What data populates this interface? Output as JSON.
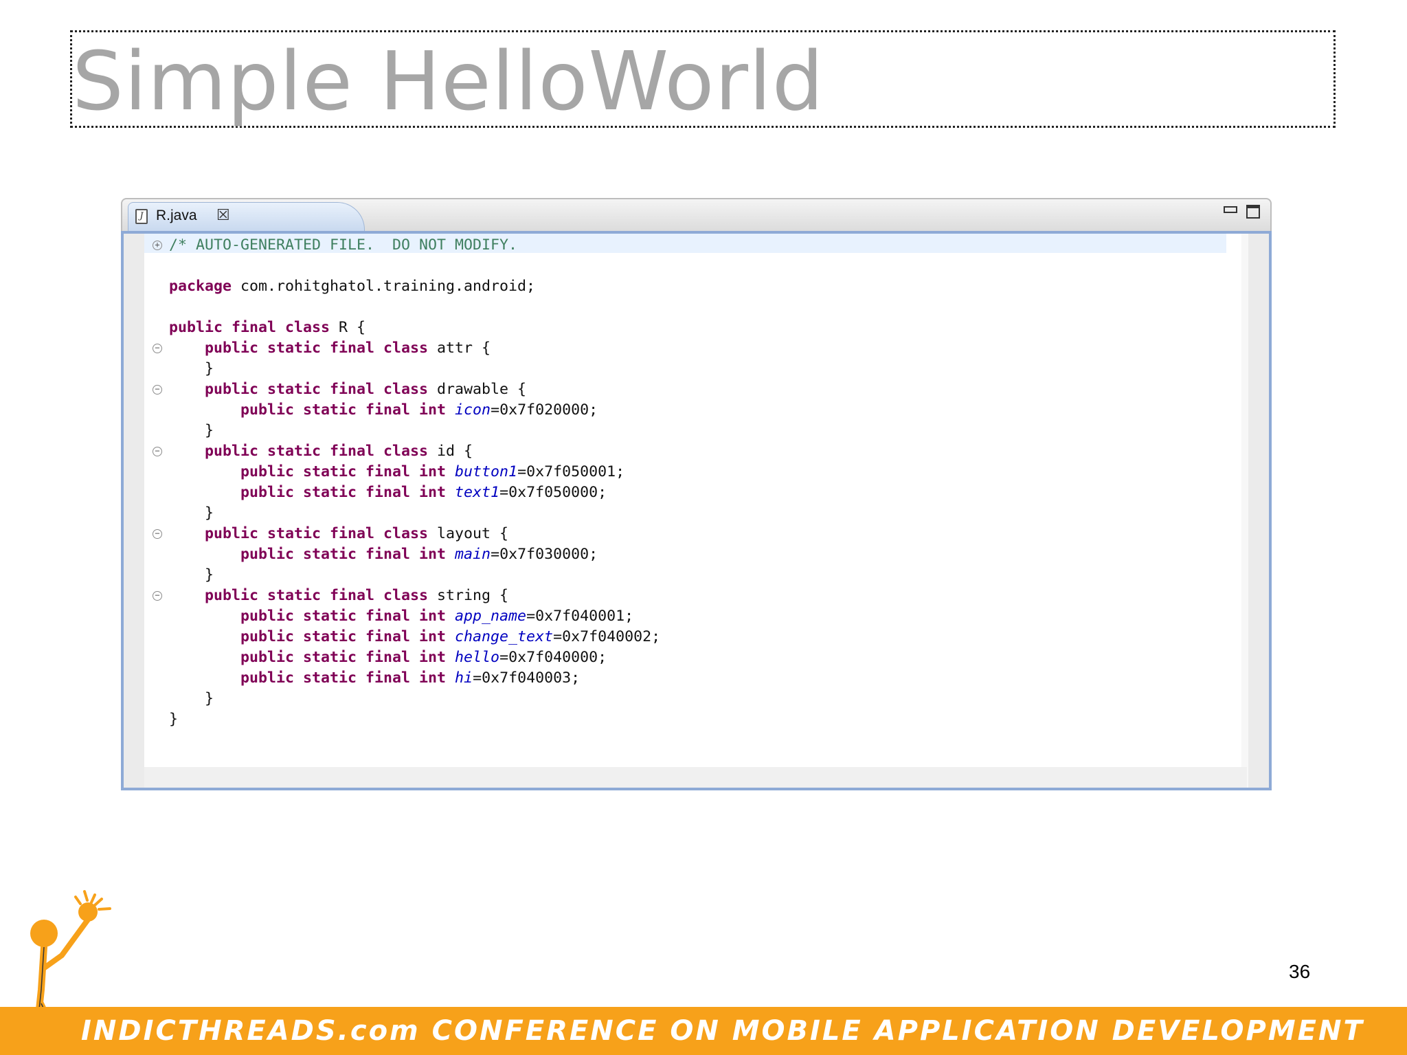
{
  "slide": {
    "title": "Simple HelloWorld",
    "page_number": "36",
    "footer": "INDICTHREADS.com CONFERENCE ON MOBILE APPLICATION DEVELOPMENT"
  },
  "editor": {
    "tab_label": "R.java",
    "tab_close_glyph": "☒",
    "file_icon_glyph": "J"
  },
  "code_lines": [
    [
      [
        "cm",
        "/* AUTO-GENERATED FILE.  DO NOT MODIFY."
      ]
    ],
    [],
    [
      [
        "kw",
        "package"
      ],
      [
        "",
        " com.rohitghatol.training.android;"
      ]
    ],
    [],
    [
      [
        "kw",
        "public final class"
      ],
      [
        "",
        " R {"
      ]
    ],
    [
      [
        "",
        "    "
      ],
      [
        "kw",
        "public static final class"
      ],
      [
        "",
        " attr {"
      ]
    ],
    [
      [
        "",
        "    }"
      ]
    ],
    [
      [
        "",
        "    "
      ],
      [
        "kw",
        "public static final class"
      ],
      [
        "",
        " drawable {"
      ]
    ],
    [
      [
        "",
        "        "
      ],
      [
        "kw",
        "public static final int"
      ],
      [
        "",
        " "
      ],
      [
        "fd",
        "icon"
      ],
      [
        "",
        "=0x7f020000;"
      ]
    ],
    [
      [
        "",
        "    }"
      ]
    ],
    [
      [
        "",
        "    "
      ],
      [
        "kw",
        "public static final class"
      ],
      [
        "",
        " id {"
      ]
    ],
    [
      [
        "",
        "        "
      ],
      [
        "kw",
        "public static final int"
      ],
      [
        "",
        " "
      ],
      [
        "fd",
        "button1"
      ],
      [
        "",
        "=0x7f050001;"
      ]
    ],
    [
      [
        "",
        "        "
      ],
      [
        "kw",
        "public static final int"
      ],
      [
        "",
        " "
      ],
      [
        "fd",
        "text1"
      ],
      [
        "",
        "=0x7f050000;"
      ]
    ],
    [
      [
        "",
        "    }"
      ]
    ],
    [
      [
        "",
        "    "
      ],
      [
        "kw",
        "public static final class"
      ],
      [
        "",
        " layout {"
      ]
    ],
    [
      [
        "",
        "        "
      ],
      [
        "kw",
        "public static final int"
      ],
      [
        "",
        " "
      ],
      [
        "fd",
        "main"
      ],
      [
        "",
        "=0x7f030000;"
      ]
    ],
    [
      [
        "",
        "    }"
      ]
    ],
    [
      [
        "",
        "    "
      ],
      [
        "kw",
        "public static final class"
      ],
      [
        "",
        " string {"
      ]
    ],
    [
      [
        "",
        "        "
      ],
      [
        "kw",
        "public static final int"
      ],
      [
        "",
        " "
      ],
      [
        "fd",
        "app_name"
      ],
      [
        "",
        "=0x7f040001;"
      ]
    ],
    [
      [
        "",
        "        "
      ],
      [
        "kw",
        "public static final int"
      ],
      [
        "",
        " "
      ],
      [
        "fd",
        "change_text"
      ],
      [
        "",
        "=0x7f040002;"
      ]
    ],
    [
      [
        "",
        "        "
      ],
      [
        "kw",
        "public static final int"
      ],
      [
        "",
        " "
      ],
      [
        "fd",
        "hello"
      ],
      [
        "",
        "=0x7f040000;"
      ]
    ],
    [
      [
        "",
        "        "
      ],
      [
        "kw",
        "public static final int"
      ],
      [
        "",
        " "
      ],
      [
        "fd",
        "hi"
      ],
      [
        "",
        "=0x7f040003;"
      ]
    ],
    [
      [
        "",
        "    }"
      ]
    ],
    [
      [
        "",
        "}"
      ]
    ]
  ],
  "fold_markers": [
    {
      "line": 0,
      "glyph": "+"
    },
    {
      "line": 5,
      "glyph": "−"
    },
    {
      "line": 7,
      "glyph": "−"
    },
    {
      "line": 10,
      "glyph": "−"
    },
    {
      "line": 14,
      "glyph": "−"
    },
    {
      "line": 17,
      "glyph": "−"
    }
  ],
  "colors": {
    "title": "#a6a6a6",
    "footer_bar": "#f7a11a",
    "keyword": "#7f0055",
    "comment": "#3f7f5f",
    "field": "#0000c0",
    "editor_border": "#8eaad6"
  },
  "icons": {
    "file": "java-file-icon",
    "close": "close-tab-icon",
    "minimize": "minimize-icon",
    "maximize": "maximize-icon",
    "logo": "indicthreads-figure-logo"
  }
}
